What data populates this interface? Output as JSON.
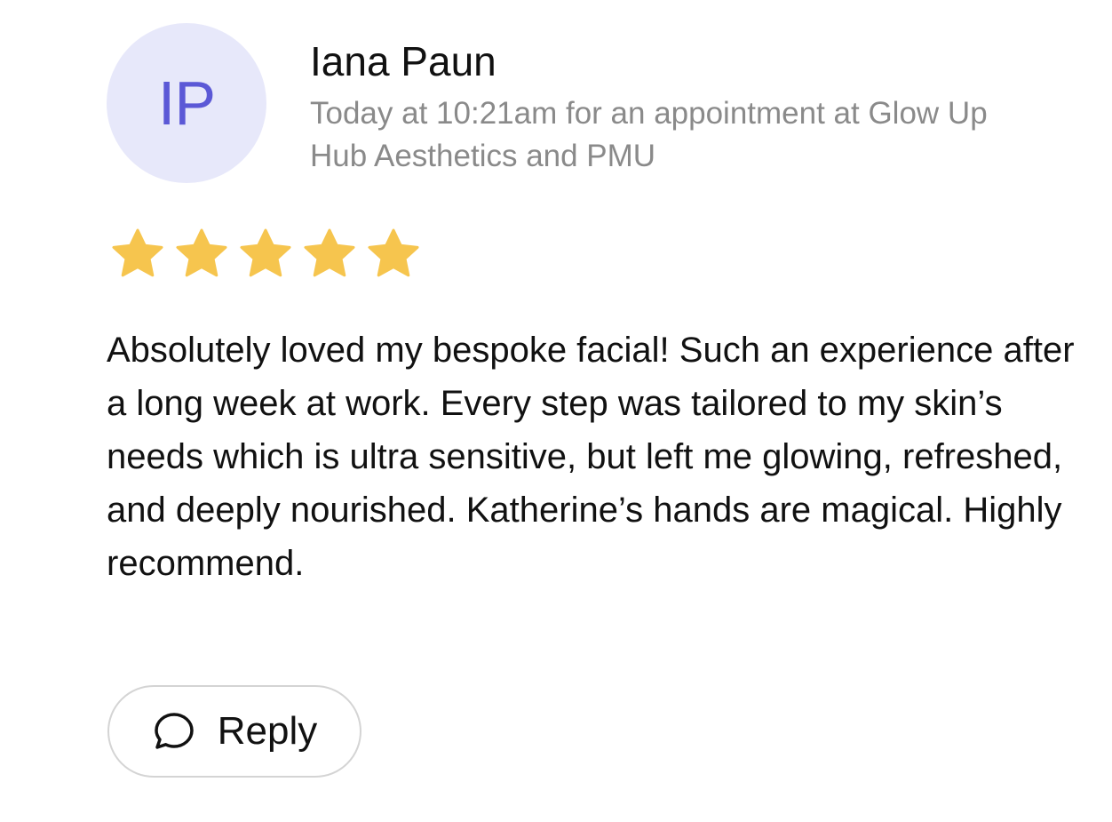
{
  "review": {
    "avatar_initials": "IP",
    "reviewer_name": "Iana Paun",
    "meta": "Today at 10:21am for an appointment at Glow Up Hub Aesthetics and PMU",
    "rating": 5,
    "rating_max": 5,
    "text": "Absolutely loved my bespoke facial! Such an experience after a long week at work. Every step was tailored to my skin’s needs which is ultra sensitive, but left me glowing, refreshed, and deeply nourished. Katherine’s hands are magical. Highly recommend.",
    "reply_label": "Reply"
  },
  "colors": {
    "avatar_bg": "#e7e8fa",
    "avatar_text": "#5b58d6",
    "star": "#f6c54e",
    "meta_text": "#8a8a8a",
    "button_border": "#d4d4d4"
  },
  "icons": {
    "star": "star-icon",
    "reply": "chat-bubble-icon"
  }
}
